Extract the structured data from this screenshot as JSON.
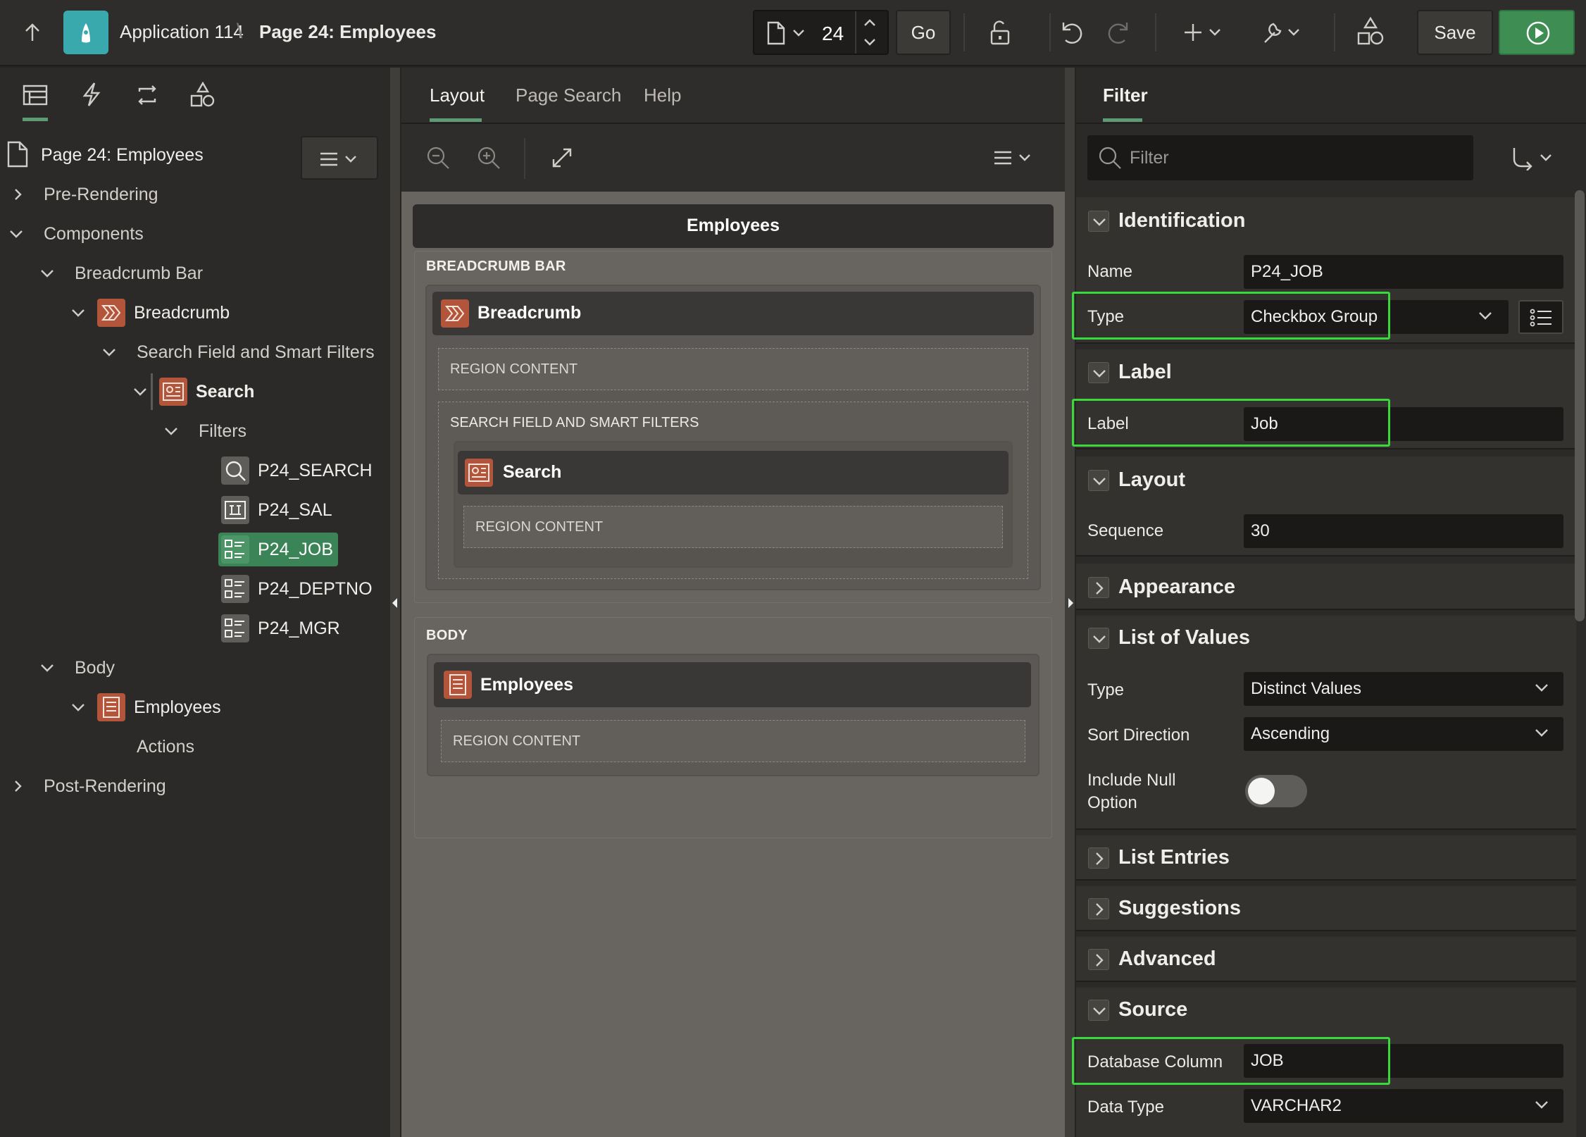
{
  "topbar": {
    "app_name": "Application 114",
    "separator": "\\",
    "page_title": "Page 24: Employees",
    "page_number": "24",
    "go_label": "Go",
    "save_label": "Save"
  },
  "left": {
    "page_node": "Page 24: Employees",
    "tree": [
      {
        "label": "Pre-Rendering"
      },
      {
        "label": "Components"
      },
      {
        "label": "Breadcrumb Bar"
      },
      {
        "label": "Breadcrumb"
      },
      {
        "label": "Search Field and Smart Filters"
      },
      {
        "label": "Search"
      },
      {
        "label": "Filters"
      },
      {
        "label": "P24_SEARCH"
      },
      {
        "label": "P24_SAL"
      },
      {
        "label": "P24_JOB"
      },
      {
        "label": "P24_DEPTNO"
      },
      {
        "label": "P24_MGR"
      },
      {
        "label": "Body"
      },
      {
        "label": "Employees"
      },
      {
        "label": "Actions"
      },
      {
        "label": "Post-Rendering"
      }
    ]
  },
  "center": {
    "tabs": [
      "Layout",
      "Page Search",
      "Help"
    ],
    "page_header": "Employees",
    "breadcrumb_bar": "BREADCRUMB BAR",
    "breadcrumb_region": "Breadcrumb",
    "region_content": "REGION CONTENT",
    "search_field": "SEARCH FIELD AND SMART FILTERS",
    "search_region": "Search",
    "body": "BODY",
    "employees_region": "Employees"
  },
  "right": {
    "tab": "Filter",
    "filter_placeholder": "Filter",
    "sections": {
      "identification": "Identification",
      "label": "Label",
      "layout": "Layout",
      "appearance": "Appearance",
      "lov": "List of Values",
      "list_entries": "List Entries",
      "suggestions": "Suggestions",
      "advanced": "Advanced",
      "source": "Source"
    },
    "props": {
      "name_label": "Name",
      "name_value": "P24_JOB",
      "type_label": "Type",
      "type_value": "Checkbox Group",
      "label_label": "Label",
      "label_value": "Job",
      "sequence_label": "Sequence",
      "sequence_value": "30",
      "lov_type_label": "Type",
      "lov_type_value": "Distinct Values",
      "sort_label": "Sort Direction",
      "sort_value": "Ascending",
      "null_label_1": "Include Null",
      "null_label_2": "Option",
      "dbcol_label": "Database Column",
      "dbcol_value": "JOB",
      "datatype_label": "Data Type",
      "datatype_value": "VARCHAR2"
    }
  },
  "colors": {
    "accent": "#5c9b76",
    "highlight": "#39d93d",
    "run": "#3e8d52",
    "orange_icon": "#b2553a",
    "app_icon": "#3aa9ad"
  }
}
